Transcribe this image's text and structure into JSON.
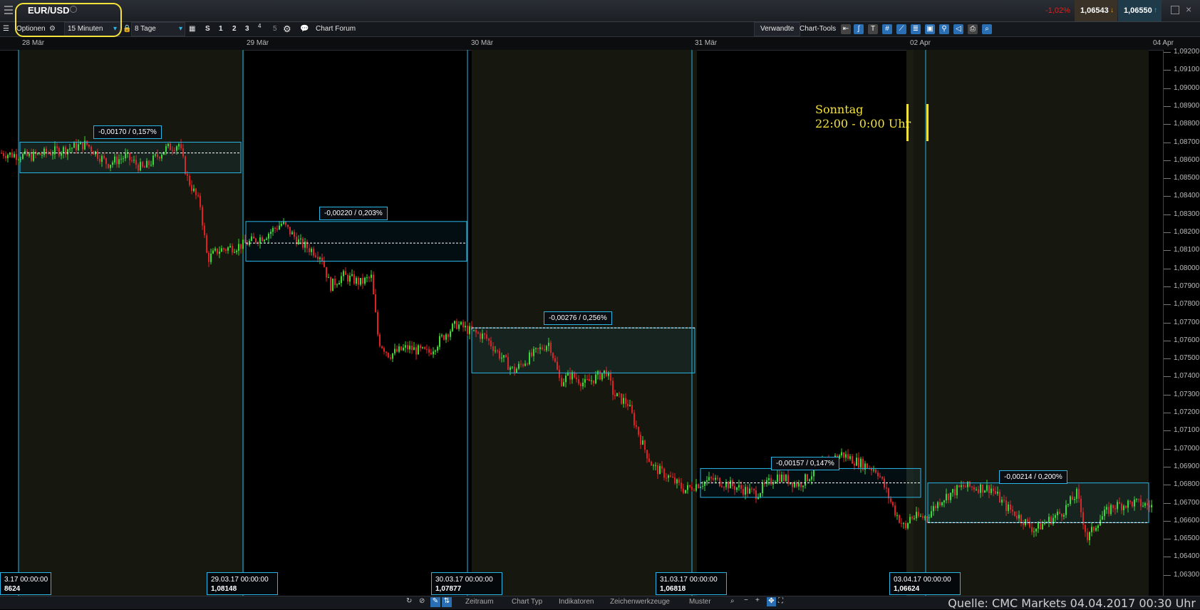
{
  "header": {
    "symbol": "EUR/USD",
    "change": "-1,02%",
    "sell_price": "1,06543",
    "buy_price": "1,06550"
  },
  "toolbar": {
    "options_label": "Optionen",
    "interval": "15 Minuten",
    "range": "8 Tage",
    "quick_buttons": [
      "S",
      "1",
      "2",
      "3",
      "4",
      "5"
    ],
    "chart_forum": "Chart Forum",
    "related": "Verwandte",
    "chart_tools": "Chart-Tools"
  },
  "date_axis": [
    "28 Mär",
    "29 Mär",
    "30 Mär",
    "31 Mär",
    "02 Apr",
    "04 Apr"
  ],
  "price_axis": [
    "1,09200",
    "1,09100",
    "1,09000",
    "1,08900",
    "1,08800",
    "1,08700",
    "1,08600",
    "1,08500",
    "1,08400",
    "1,08300",
    "1,08200",
    "1,08100",
    "1,08000",
    "1,07900",
    "1,07800",
    "1,07700",
    "1,07600",
    "1,07500",
    "1,07400",
    "1,07300",
    "1,07200",
    "1,07100",
    "1,07000",
    "1,06900",
    "1,06800",
    "1,06700",
    "1,06600",
    "1,06500",
    "1,06400",
    "1,06300"
  ],
  "annotations": [
    "-0,00170 / 0,157%",
    "-0,00220 / 0,203%",
    "-0,00276 / 0,256%",
    "-0,00157 / 0,147%",
    "-0,00214 / 0,200%"
  ],
  "date_boxes": [
    {
      "date": "3.17 00:00:00",
      "price": "8624"
    },
    {
      "date": "29.03.17 00:00:00",
      "price": "1,08148"
    },
    {
      "date": "30.03.17 00:00:00",
      "price": "1,07877"
    },
    {
      "date": "31.03.17 00:00:00",
      "price": "1,06818"
    },
    {
      "date": "03.04.17 00:00:00",
      "price": "1,06624"
    }
  ],
  "note": {
    "line1": "Sonntag",
    "line2": "22:00 - 0:00 Uhr"
  },
  "bottom_tabs": [
    "Zeitraum",
    "Chart Typ",
    "Indikatoren",
    "Zeichenwerkzeuge",
    "Muster"
  ],
  "source": "Quelle: CMC Markets 04.04.2017 00:30 Uhr",
  "colors": {
    "up": "#3ddc2b",
    "down": "#e02020",
    "accent": "#29b6e6",
    "highlight": "#f5e23a"
  }
}
